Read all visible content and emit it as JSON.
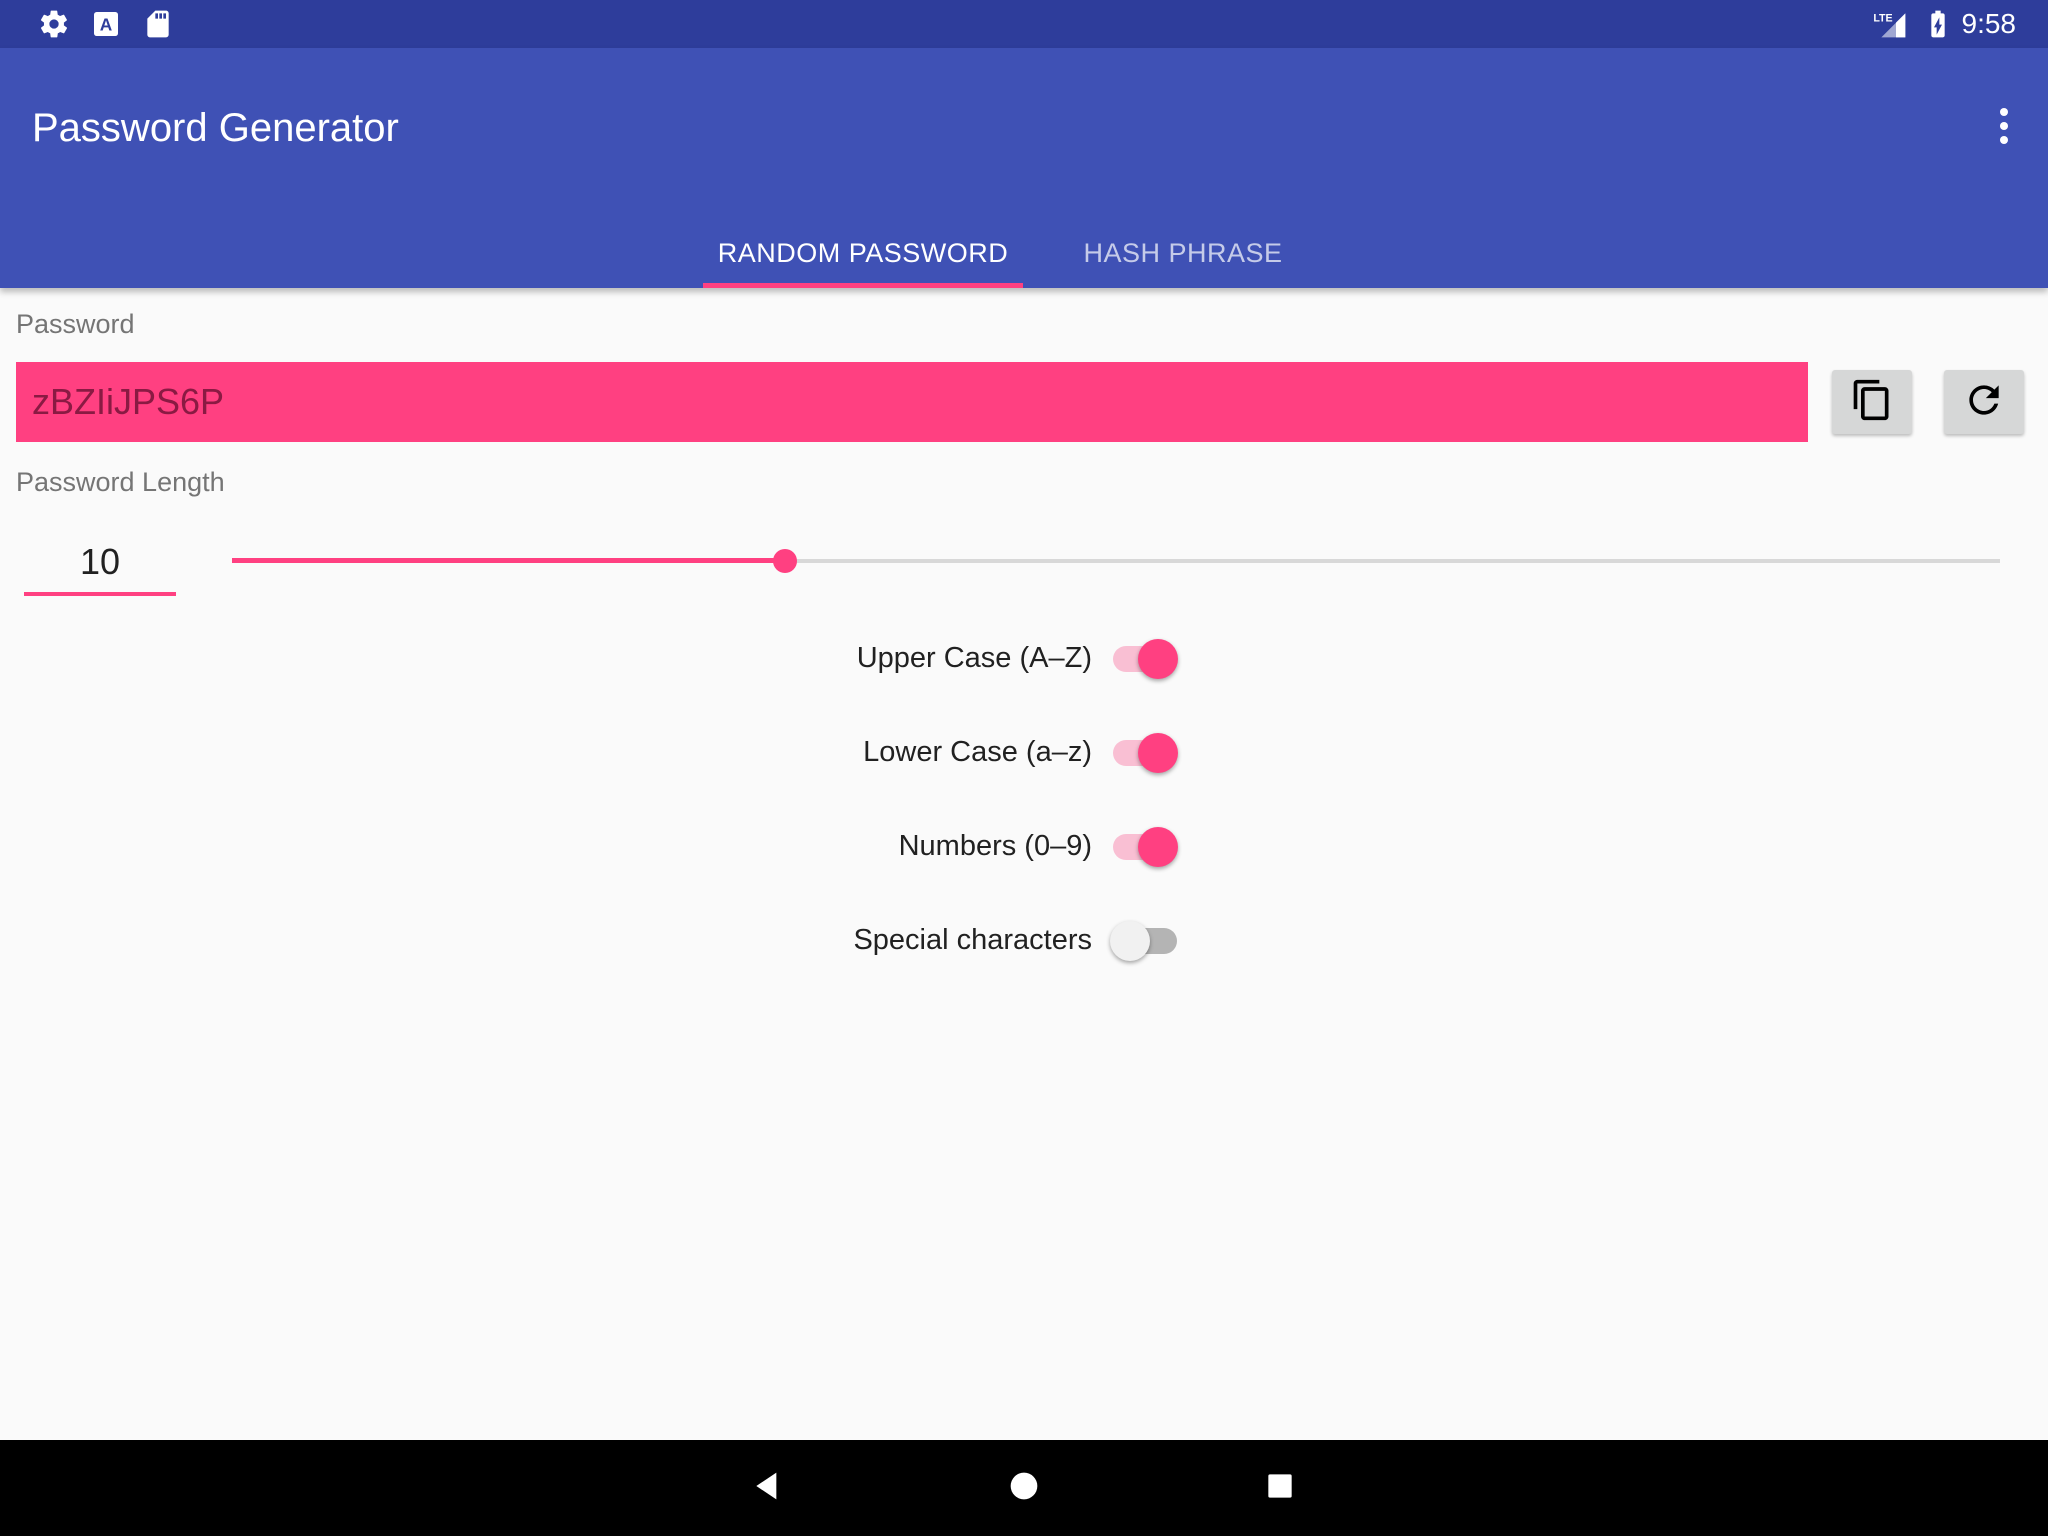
{
  "status_bar": {
    "time": "9:58",
    "left_icons": [
      "settings-icon",
      "text-a-icon",
      "sd-card-icon"
    ],
    "right_icons": [
      "lte-signal-icon",
      "battery-charging-icon"
    ]
  },
  "app_bar": {
    "title": "Password Generator",
    "menu_icon": "more-vert-icon",
    "tabs": [
      {
        "label": "RANDOM PASSWORD",
        "selected": true
      },
      {
        "label": "HASH PHRASE",
        "selected": false
      }
    ]
  },
  "password": {
    "label": "Password",
    "value": "zBZIiJPS6P",
    "copy_icon": "content-copy-icon",
    "refresh_icon": "refresh-icon"
  },
  "length": {
    "label": "Password Length",
    "value": "10",
    "slider_fraction": 0.313
  },
  "options": [
    {
      "label": "Upper Case (A–Z)",
      "checked": true
    },
    {
      "label": "Lower Case (a–z)",
      "checked": true
    },
    {
      "label": "Numbers (0–9)",
      "checked": true
    },
    {
      "label": "Special characters",
      "checked": false
    }
  ],
  "nav_bar": {
    "icons": [
      "back-icon",
      "home-icon",
      "recents-icon"
    ]
  },
  "colors": {
    "status_bar": "#2e3d9b",
    "primary": "#3f51b5",
    "accent": "#ff4081",
    "background": "#fafafa"
  }
}
